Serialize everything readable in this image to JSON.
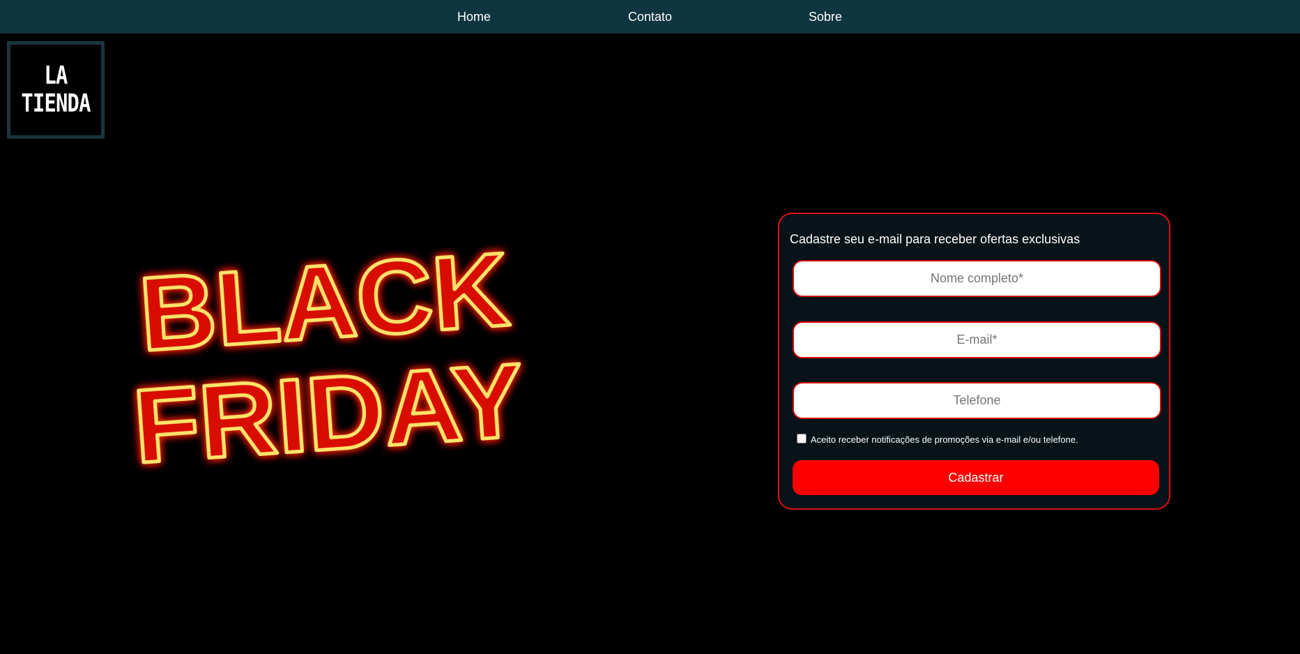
{
  "nav": {
    "home": "Home",
    "contato": "Contato",
    "sobre": "Sobre"
  },
  "logo": {
    "line1": "LA",
    "line2": "TIENDA"
  },
  "hero": {
    "line1": "BLACK",
    "line2": "FRIDAY"
  },
  "signup": {
    "title": "Cadastre seu e-mail para receber ofertas exclusivas",
    "name_placeholder": "Nome completo*",
    "email_placeholder": "E-mail*",
    "phone_placeholder": "Telefone",
    "consent_label": "Aceito receber notificações de promoções via e-mail e/ou telefone.",
    "consent_checked": false,
    "submit_label": "Cadastrar"
  },
  "colors": {
    "navbar_bg": "#0f3540",
    "accent_red": "#fe0000",
    "card_border": "#e01010",
    "neon_core": "#ffe36b",
    "neon_glow": "#ff2200"
  }
}
